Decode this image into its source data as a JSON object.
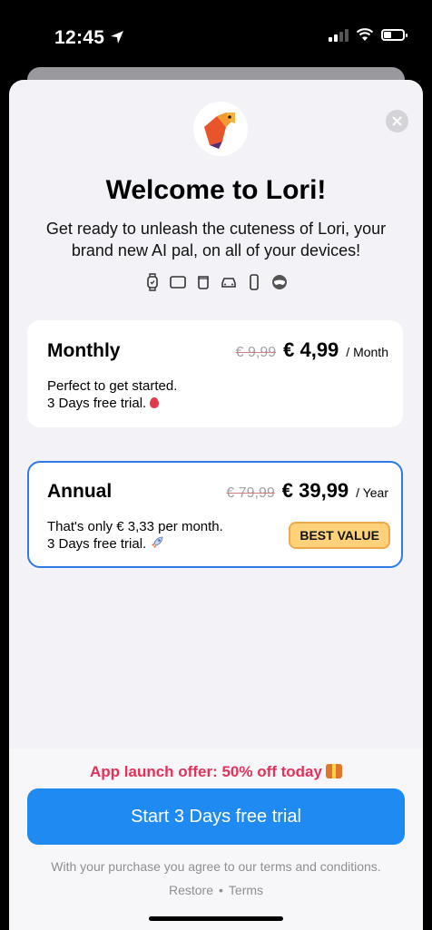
{
  "status": {
    "time": "12:45"
  },
  "header": {
    "title": "Welcome to Lori!",
    "subtitle": "Get ready to unleash the cuteness of Lori, your brand new AI pal, on all of your devices!",
    "device_icons": [
      "watch-icon",
      "ipad-icon",
      "mac-icon",
      "car-icon",
      "iphone-icon",
      "vision-icon"
    ]
  },
  "plans": [
    {
      "name": "Monthly",
      "old_price": "€ 9,99",
      "new_price": "€ 4,99",
      "period": "/ Month",
      "line1": "Perfect to get started.",
      "line2": "3 Days free trial."
    },
    {
      "name": "Annual",
      "old_price": "€ 79,99",
      "new_price": "€ 39,99",
      "period": "/ Year",
      "line1": "That's only € 3,33 per month.",
      "line2": "3 Days free trial.",
      "badge": "BEST VALUE"
    }
  ],
  "footer": {
    "offer": "App launch offer: 50% off today",
    "cta": "Start 3 Days free trial",
    "legal": "With your purchase you agree to our terms and conditions.",
    "restore": "Restore",
    "separator": "•",
    "terms": "Terms"
  },
  "colors": {
    "accent": "#1f8bf2",
    "offer": "#e2325a",
    "badge_bg": "#ffd27a"
  }
}
